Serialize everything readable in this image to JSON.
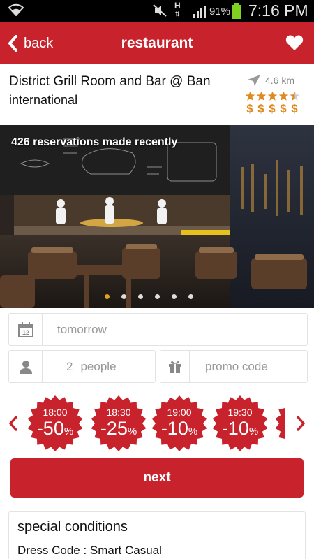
{
  "status_bar": {
    "battery_percent": "91%",
    "time": "7:16 PM",
    "network_type": "H",
    "icons": [
      "wifi-icon",
      "mute-icon",
      "signal-icon",
      "battery-icon"
    ]
  },
  "header": {
    "back_label": "back",
    "title": "restaurant",
    "icons": [
      "chevron-left-icon",
      "heart-icon"
    ]
  },
  "restaurant": {
    "name": "District Grill Room and Bar @  Ban",
    "cuisine": "international",
    "distance": "4.6 km",
    "rating": 4.5,
    "price_symbols": [
      "$",
      "$",
      "$",
      "$",
      "$"
    ]
  },
  "photo": {
    "caption": "426 reservations made recently",
    "slides_total": 6,
    "active_slide": 1
  },
  "booking": {
    "date_value": "tomorrow",
    "people_count": "2",
    "people_label": "people",
    "promo_placeholder": "promo code"
  },
  "time_slots": [
    {
      "time": "18:00",
      "discount": "-50",
      "unit": "%"
    },
    {
      "time": "18:30",
      "discount": "-25",
      "unit": "%"
    },
    {
      "time": "19:00",
      "discount": "-10",
      "unit": "%"
    },
    {
      "time": "19:30",
      "discount": "-10",
      "unit": "%"
    }
  ],
  "next_label": "next",
  "conditions": {
    "title": "special conditions",
    "dress_code": "Dress Code : Smart Casual"
  },
  "colors": {
    "brand_red": "#c8232c",
    "star_orange": "#e08a1e",
    "battery_green": "#7ed321"
  }
}
